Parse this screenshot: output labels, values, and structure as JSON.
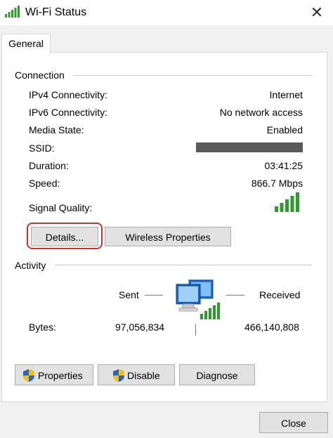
{
  "window": {
    "title": "Wi-Fi Status",
    "icon": "wifi-signal-icon",
    "close_glyph": "✕"
  },
  "tabs": [
    {
      "label": "General",
      "active": true
    }
  ],
  "connection": {
    "heading": "Connection",
    "rows": [
      {
        "label": "IPv4 Connectivity:",
        "value": "Internet"
      },
      {
        "label": "IPv6 Connectivity:",
        "value": "No network access"
      },
      {
        "label": "Media State:",
        "value": "Enabled"
      },
      {
        "label": "SSID:",
        "value": ""
      },
      {
        "label": "Duration:",
        "value": "03:41:25"
      },
      {
        "label": "Speed:",
        "value": "866.7 Mbps"
      }
    ],
    "ssid_redacted": true,
    "signal_quality_label": "Signal Quality:",
    "signal_bars": 5,
    "signal_bars_max": 5,
    "details_button": "Details...",
    "wireless_properties_button": "Wireless Properties"
  },
  "activity": {
    "heading": "Activity",
    "sent_label": "Sent",
    "received_label": "Received",
    "bytes_label": "Bytes:",
    "bytes_sent": "97,056,834",
    "bytes_received": "466,140,808"
  },
  "buttons": {
    "properties": "Properties",
    "disable": "Disable",
    "diagnose": "Diagnose",
    "close": "Close"
  },
  "colors": {
    "signal_green": "#2e9b2e",
    "highlight_ring": "#d0302d",
    "shield_blue": "#2a63c4",
    "shield_yellow": "#f2c20f"
  }
}
